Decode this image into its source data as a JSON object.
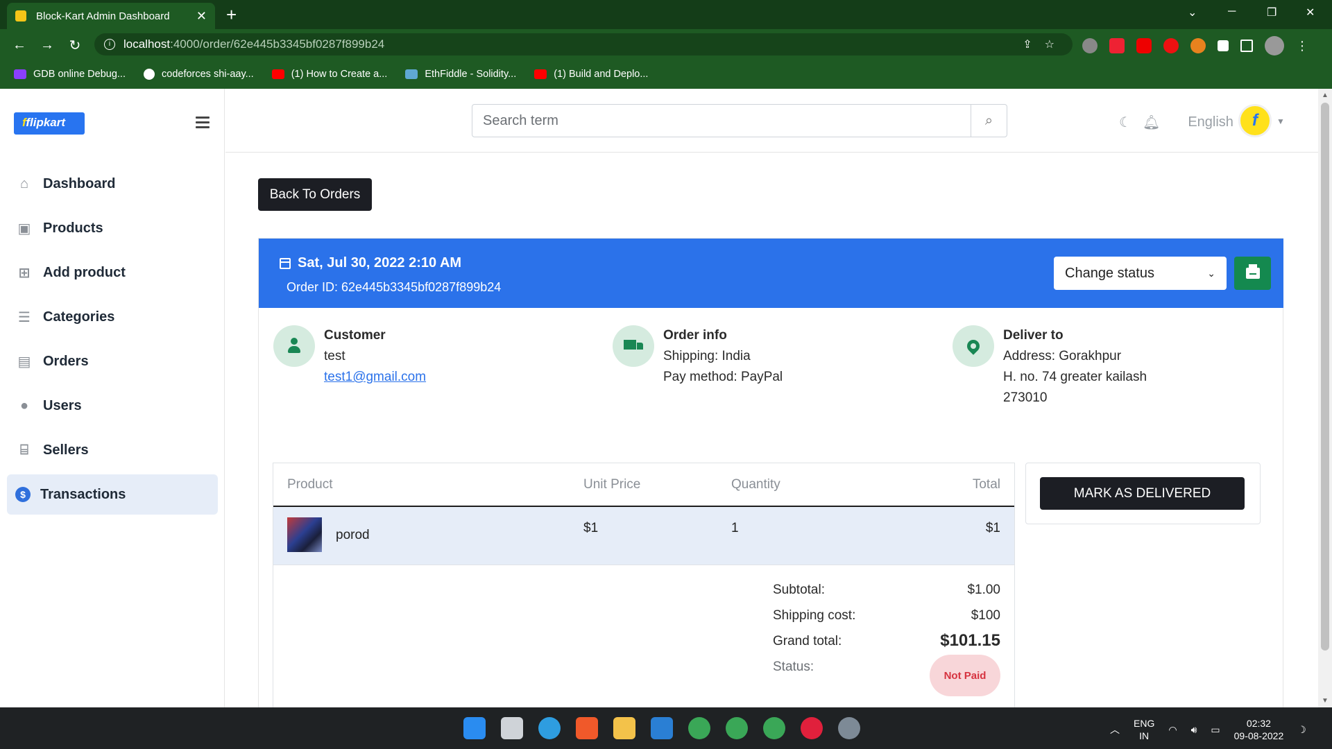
{
  "browser": {
    "tab_title": "Block-Kart Admin Dashboard",
    "url_host": "localhost",
    "url_path": ":4000/order/62e445b3345bf0287f899b24",
    "bookmarks": [
      {
        "label": "GDB online Debug...",
        "color": "#8a3ffc"
      },
      {
        "label": "codeforces shi-aay...",
        "color": "#ffffff"
      },
      {
        "label": "(1) How to Create a...",
        "color": "#ff0000"
      },
      {
        "label": "EthFiddle - Solidity...",
        "color": "#5fa8d3"
      },
      {
        "label": "(1) Build and Deplo...",
        "color": "#ff0000"
      }
    ]
  },
  "sidebar": {
    "logo": "flipkart",
    "items": [
      {
        "label": "Dashboard",
        "icon": "home-icon"
      },
      {
        "label": "Products",
        "icon": "bag-icon"
      },
      {
        "label": "Add product",
        "icon": "cart-plus-icon"
      },
      {
        "label": "Categories",
        "icon": "list-icon"
      },
      {
        "label": "Orders",
        "icon": "bag-check-icon"
      },
      {
        "label": "Users",
        "icon": "user-icon"
      },
      {
        "label": "Sellers",
        "icon": "shop-icon"
      },
      {
        "label": "Transactions",
        "icon": "dollar-icon"
      }
    ],
    "active_index": 7
  },
  "topbar": {
    "search_placeholder": "Search term",
    "language": "English"
  },
  "order": {
    "back_label": "Back To Orders",
    "date": "Sat, Jul 30, 2022 2:10 AM",
    "order_id": "Order ID: 62e445b3345bf0287f899b24",
    "status_select": "Change status",
    "customer": {
      "title": "Customer",
      "name": "test",
      "email": "test1@gmail.com"
    },
    "order_info": {
      "title": "Order info",
      "shipping": "Shipping: India",
      "pay_method": "Pay method: PayPal"
    },
    "deliver_to": {
      "title": "Deliver to",
      "address": "Address: Gorakhpur",
      "line2": "H. no. 74 greater kailash",
      "pin": "273010"
    },
    "table": {
      "headers": [
        "Product",
        "Unit Price",
        "Quantity",
        "Total"
      ],
      "rows": [
        {
          "product": "porod",
          "unit_price": "$1",
          "quantity": "1",
          "total": "$1"
        }
      ]
    },
    "totals": {
      "subtotal_label": "Subtotal:",
      "subtotal": "$1.00",
      "shipping_label": "Shipping cost:",
      "shipping": "$100",
      "grand_label": "Grand total:",
      "grand": "$101.15",
      "status_label": "Status:",
      "status": "Not Paid"
    },
    "mark_delivered": "MARK AS DELIVERED"
  },
  "taskbar": {
    "lang_top": "ENG",
    "lang_bottom": "IN",
    "time": "02:32",
    "date": "09-08-2022"
  },
  "colors": {
    "chrome": "#1e5a23",
    "header_blue": "#2b72ea",
    "print_green": "#14894f",
    "badge_red": "#d6323f"
  }
}
